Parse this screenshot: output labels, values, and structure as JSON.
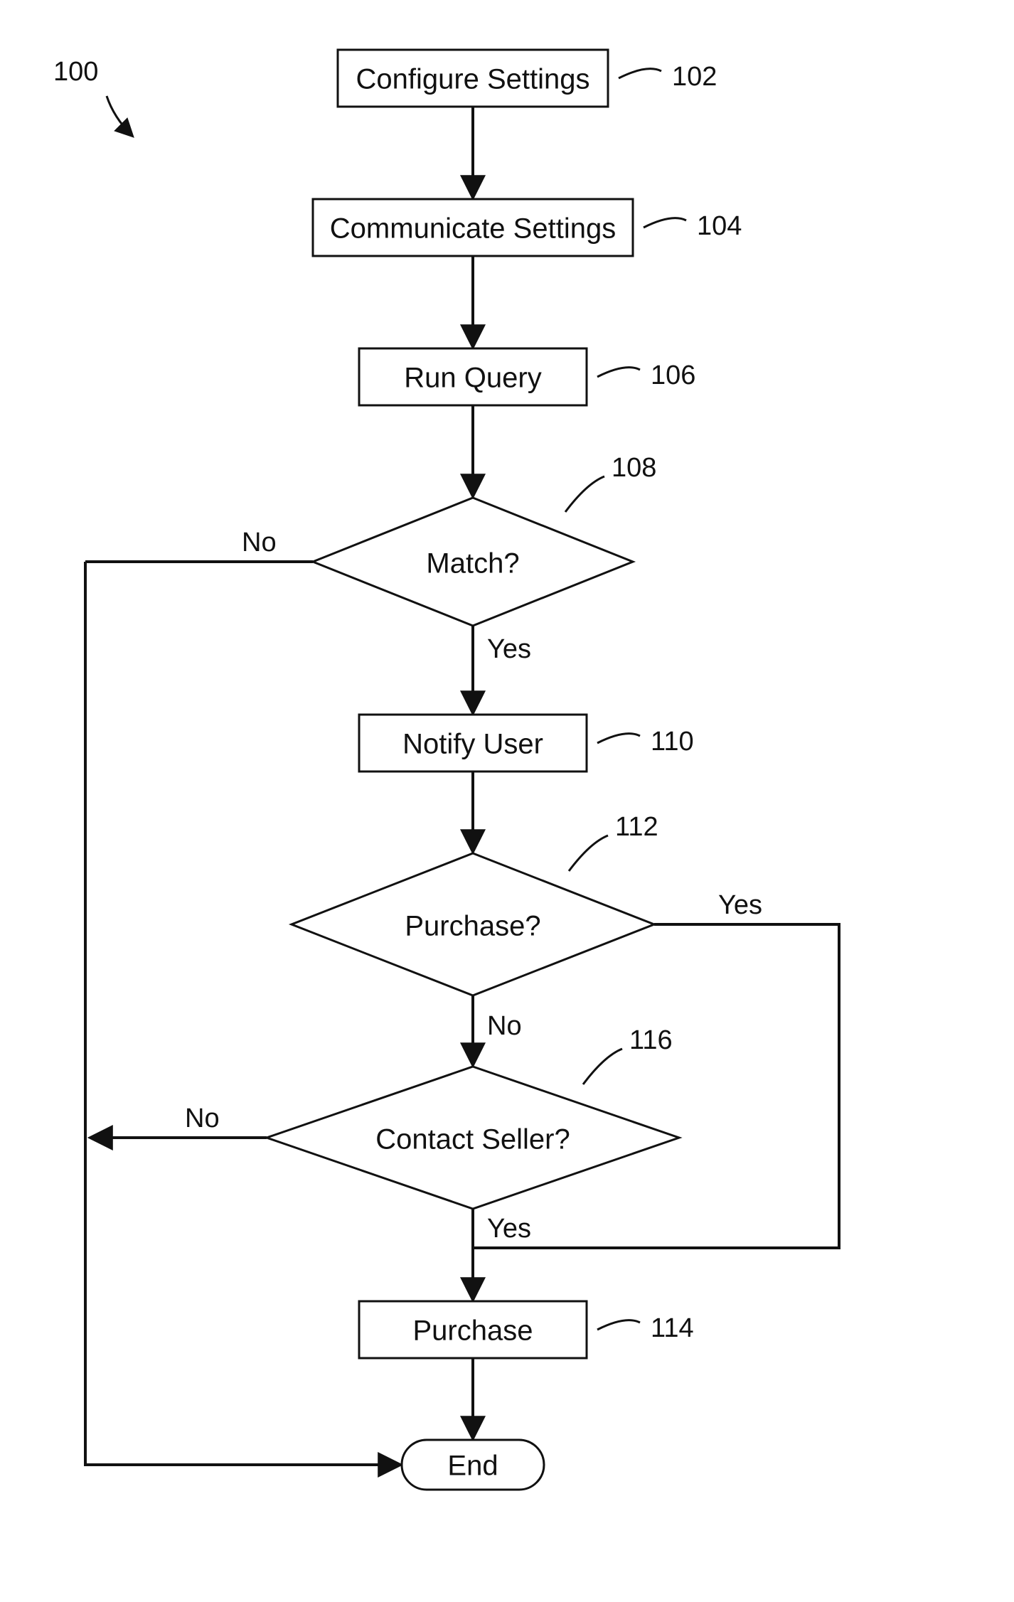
{
  "chart_data": {
    "type": "flowchart",
    "title": "",
    "figure_ref": "100",
    "nodes": [
      {
        "id": "102",
        "type": "process",
        "label": "Configure Settings"
      },
      {
        "id": "104",
        "type": "process",
        "label": "Communicate Settings"
      },
      {
        "id": "106",
        "type": "process",
        "label": "Run Query"
      },
      {
        "id": "108",
        "type": "decision",
        "label": "Match?"
      },
      {
        "id": "110",
        "type": "process",
        "label": "Notify User"
      },
      {
        "id": "112",
        "type": "decision",
        "label": "Purchase?"
      },
      {
        "id": "116",
        "type": "decision",
        "label": "Contact Seller?"
      },
      {
        "id": "114",
        "type": "process",
        "label": "Purchase"
      },
      {
        "id": "end",
        "type": "terminator",
        "label": "End"
      }
    ],
    "edges": [
      {
        "from": "102",
        "to": "104",
        "label": ""
      },
      {
        "from": "104",
        "to": "106",
        "label": ""
      },
      {
        "from": "106",
        "to": "108",
        "label": ""
      },
      {
        "from": "108",
        "to": "110",
        "label": "Yes"
      },
      {
        "from": "108",
        "to": "end",
        "label": "No"
      },
      {
        "from": "110",
        "to": "112",
        "label": ""
      },
      {
        "from": "112",
        "to": "114",
        "label": "Yes"
      },
      {
        "from": "112",
        "to": "116",
        "label": "No"
      },
      {
        "from": "116",
        "to": "114",
        "label": "Yes"
      },
      {
        "from": "116",
        "to": "end",
        "label": "No"
      },
      {
        "from": "114",
        "to": "end",
        "label": ""
      }
    ]
  },
  "labels": {
    "yes": "Yes",
    "no": "No"
  }
}
